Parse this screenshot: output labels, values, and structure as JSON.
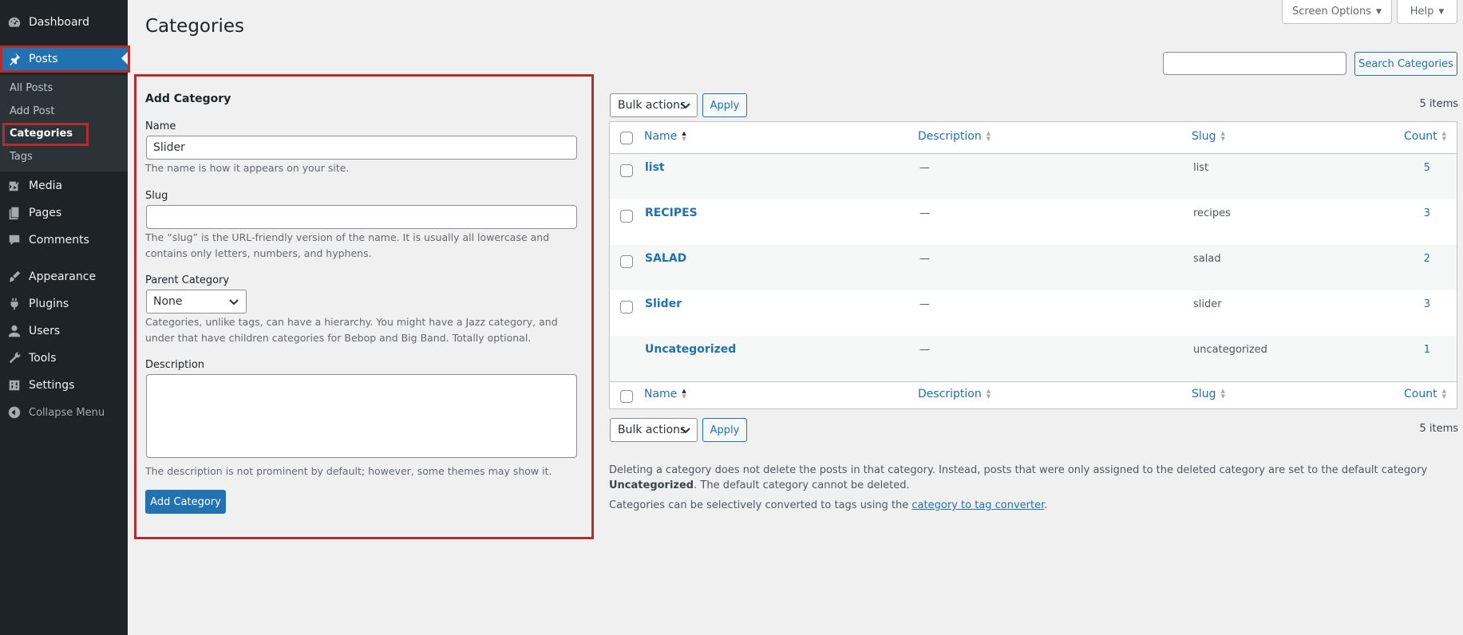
{
  "sidebar": {
    "dashboard": "Dashboard",
    "posts": "Posts",
    "submenu": {
      "all_posts": "All Posts",
      "add_post": "Add Post",
      "categories": "Categories",
      "tags": "Tags"
    },
    "media": "Media",
    "pages": "Pages",
    "comments": "Comments",
    "appearance": "Appearance",
    "plugins": "Plugins",
    "users": "Users",
    "tools": "Tools",
    "settings": "Settings",
    "collapse": "Collapse Menu"
  },
  "header": {
    "title": "Categories",
    "screen_options": "Screen Options",
    "help": "Help"
  },
  "form": {
    "title": "Add Category",
    "name_label": "Name",
    "name_value": "Slider",
    "name_help": "The name is how it appears on your site.",
    "slug_label": "Slug",
    "slug_value": "",
    "slug_help": "The “slug” is the URL-friendly version of the name. It is usually all lowercase and contains only letters, numbers, and hyphens.",
    "parent_label": "Parent Category",
    "parent_value": "None",
    "parent_help": "Categories, unlike tags, can have a hierarchy. You might have a Jazz category, and under that have children categories for Bebop and Big Band. Totally optional.",
    "description_label": "Description",
    "description_help": "The description is not prominent by default; however, some themes may show it.",
    "submit": "Add Category"
  },
  "search": {
    "button": "Search Categories"
  },
  "bulk": {
    "label": "Bulk actions",
    "apply": "Apply",
    "items": "5 items"
  },
  "table": {
    "columns": {
      "name": "Name",
      "description": "Description",
      "slug": "Slug",
      "count": "Count"
    },
    "rows": [
      {
        "name": "list",
        "description": "—",
        "slug": "list",
        "count": "5"
      },
      {
        "name": "RECIPES",
        "description": "—",
        "slug": "recipes",
        "count": "3"
      },
      {
        "name": "SALAD",
        "description": "—",
        "slug": "salad",
        "count": "2"
      },
      {
        "name": "Slider",
        "description": "—",
        "slug": "slider",
        "count": "3"
      },
      {
        "name": "Uncategorized",
        "description": "—",
        "slug": "uncategorized",
        "count": "1"
      }
    ]
  },
  "notes": {
    "delete_prefix": "Deleting a category does not delete the posts in that category. Instead, posts that were only assigned to the deleted category are set to the default category ",
    "default_category": "Uncategorized",
    "delete_suffix": ". The default category cannot be deleted.",
    "convert_prefix": "Categories can be selectively converted to tags using the ",
    "convert_link": "category to tag converter",
    "convert_suffix": "."
  },
  "colors": {
    "accent": "#2271b1",
    "sidebar": "#1d2327",
    "highlight": "#b32d2e"
  },
  "icons": [
    "dashboard-icon",
    "pin-icon",
    "media-icon",
    "pages-icon",
    "comments-icon",
    "appearance-icon",
    "plugins-icon",
    "users-icon",
    "tools-icon",
    "settings-icon",
    "collapse-icon"
  ]
}
